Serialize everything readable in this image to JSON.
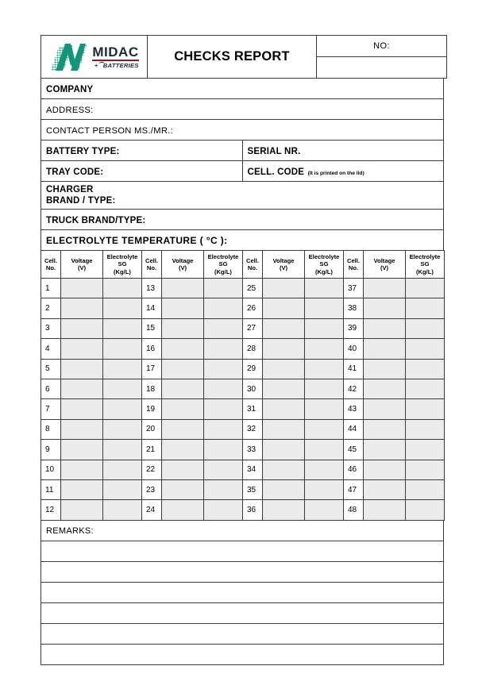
{
  "document": {
    "title": "CHECKS REPORT",
    "logo": {
      "brand": "MIDAC",
      "tagline": "+⏠BATTERIES",
      "mark_color": "#12967a",
      "rule_color": "#8c1b1b",
      "word_color": "#1b2a33"
    },
    "number_label": "NO:",
    "number_value": ""
  },
  "info_rows": {
    "company_label": "COMPANY",
    "company_value": "",
    "address_label": "ADDRESS:",
    "address_value": "",
    "contact_label": "CONTACT PERSON MS./MR.:",
    "contact_value": "",
    "battery_type_label": "BATTERY TYPE:",
    "battery_type_value": "",
    "serial_nr_label": "SERIAL NR.",
    "serial_nr_value": "",
    "tray_code_label": "TRAY CODE:",
    "tray_code_value": "",
    "cell_code_label": "CELL. CODE",
    "cell_code_note": "(It is printed on the lid)",
    "cell_code_value": "",
    "charger_label_line1": "CHARGER",
    "charger_label_line2": "BRAND / TYPE:",
    "charger_value": "",
    "truck_label": "TRUCK BRAND/TYPE:",
    "truck_value": ""
  },
  "section": {
    "electrolyte_temperature_label": "ELECTROLYTE TEMPERATURE ( °C ):",
    "electrolyte_temperature_value": ""
  },
  "grid": {
    "headers": {
      "cell_no_line1": "Cell.",
      "cell_no_line2": "No.",
      "voltage_line1": "Voltage",
      "voltage_line2": "(V)",
      "sg_line1": "Electrolyte SG",
      "sg_line2": "(Kg/L)"
    },
    "blocks": 4,
    "rows": [
      {
        "n1": "1",
        "n2": "13",
        "n3": "25",
        "n4": "37"
      },
      {
        "n1": "2",
        "n2": "14",
        "n3": "26",
        "n4": "38"
      },
      {
        "n1": "3",
        "n2": "15",
        "n3": "27",
        "n4": "39"
      },
      {
        "n1": "4",
        "n2": "16",
        "n3": "28",
        "n4": "40"
      },
      {
        "n1": "5",
        "n2": "17",
        "n3": "29",
        "n4": "41"
      },
      {
        "n1": "6",
        "n2": "18",
        "n3": "30",
        "n4": "42"
      },
      {
        "n1": "7",
        "n2": "19",
        "n3": "31",
        "n4": "43"
      },
      {
        "n1": "8",
        "n2": "20",
        "n3": "32",
        "n4": "44"
      },
      {
        "n1": "9",
        "n2": "21",
        "n3": "33",
        "n4": "45"
      },
      {
        "n1": "10",
        "n2": "22",
        "n3": "34",
        "n4": "46"
      },
      {
        "n1": "11",
        "n2": "23",
        "n3": "35",
        "n4": "47"
      },
      {
        "n1": "12",
        "n2": "24",
        "n3": "36",
        "n4": "48"
      }
    ]
  },
  "remarks": {
    "label": "REMARKS:",
    "lines": [
      "",
      "",
      "",
      "",
      "",
      ""
    ]
  },
  "colors": {
    "border": "#3a3a3a",
    "field_fill": "#ebebeb",
    "page_bg": "#ffffff"
  }
}
